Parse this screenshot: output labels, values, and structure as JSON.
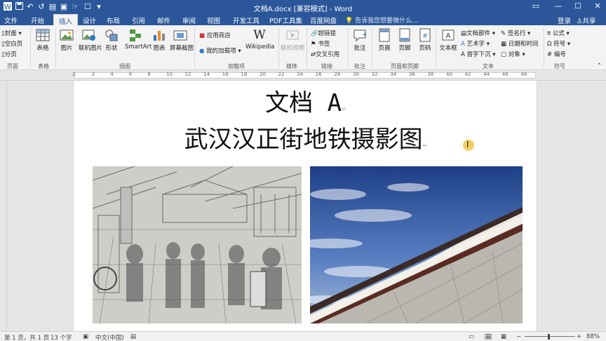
{
  "window": {
    "title": "文档A.docx [兼容模式] - Word",
    "controls": [
      "restore-icon",
      "minimize-icon",
      "maximize-icon",
      "close-icon"
    ]
  },
  "quick_access": [
    "word-logo-icon",
    "save-icon",
    "undo-icon",
    "redo-icon",
    "print-preview-icon",
    "open-icon",
    "touch-mode-icon",
    "customize-icon"
  ],
  "tabs": [
    "文件",
    "开始",
    "插入",
    "设计",
    "布局",
    "引用",
    "邮件",
    "审阅",
    "视图",
    "开发工具",
    "PDF工具集",
    "百度网盘"
  ],
  "active_tab": "插入",
  "tell_me": "告诉我您想要做什么...",
  "login": "登录",
  "share": "共享",
  "ribbon": {
    "pages": {
      "label": "页面",
      "items": [
        "封面",
        "空白页",
        "分页"
      ]
    },
    "tables": {
      "label": "表格",
      "items": [
        "表格"
      ]
    },
    "illustrations": {
      "label": "插图",
      "items": [
        "图片",
        "联机图片",
        "形状",
        "SmartArt",
        "图表",
        "屏幕截图"
      ]
    },
    "addins": {
      "label": "加载项",
      "items": [
        "应用商店",
        "我的加载项",
        "Wikipedia"
      ]
    },
    "media": {
      "label": "媒体",
      "items": [
        "联机视频"
      ]
    },
    "links": {
      "label": "链接",
      "items": [
        "超链接",
        "书签",
        "交叉引用"
      ]
    },
    "comments": {
      "label": "批注",
      "items": [
        "批注"
      ]
    },
    "header_footer": {
      "label": "页眉和页脚",
      "items": [
        "页眉",
        "页脚",
        "页码"
      ]
    },
    "text": {
      "label": "文本",
      "items": [
        "文本框",
        "文档部件",
        "艺术字",
        "首字下沉",
        "签名行",
        "日期和时间",
        "对象"
      ]
    },
    "symbols": {
      "label": "符号",
      "items": [
        "公式",
        "符号",
        "编号"
      ]
    }
  },
  "ruler": {
    "ticks": [
      "2",
      "2",
      "4",
      "6",
      "8",
      "10",
      "12",
      "14",
      "16",
      "18",
      "20",
      "22",
      "24",
      "26",
      "28",
      "30",
      "32",
      "34",
      "36",
      "38",
      "40",
      "42",
      "44",
      "46",
      "48"
    ]
  },
  "document": {
    "title_line1": "文档 A",
    "title_line2": "武汉汉正街地铁摄影图",
    "para_mark": "↵"
  },
  "status": {
    "page": "第 1 页，共 1 页",
    "words": "13 个字",
    "language": "中文(中国)",
    "zoom": "88%"
  },
  "colors": {
    "accent": "#2b579a",
    "ribbon_bg": "#f3f3f3"
  }
}
